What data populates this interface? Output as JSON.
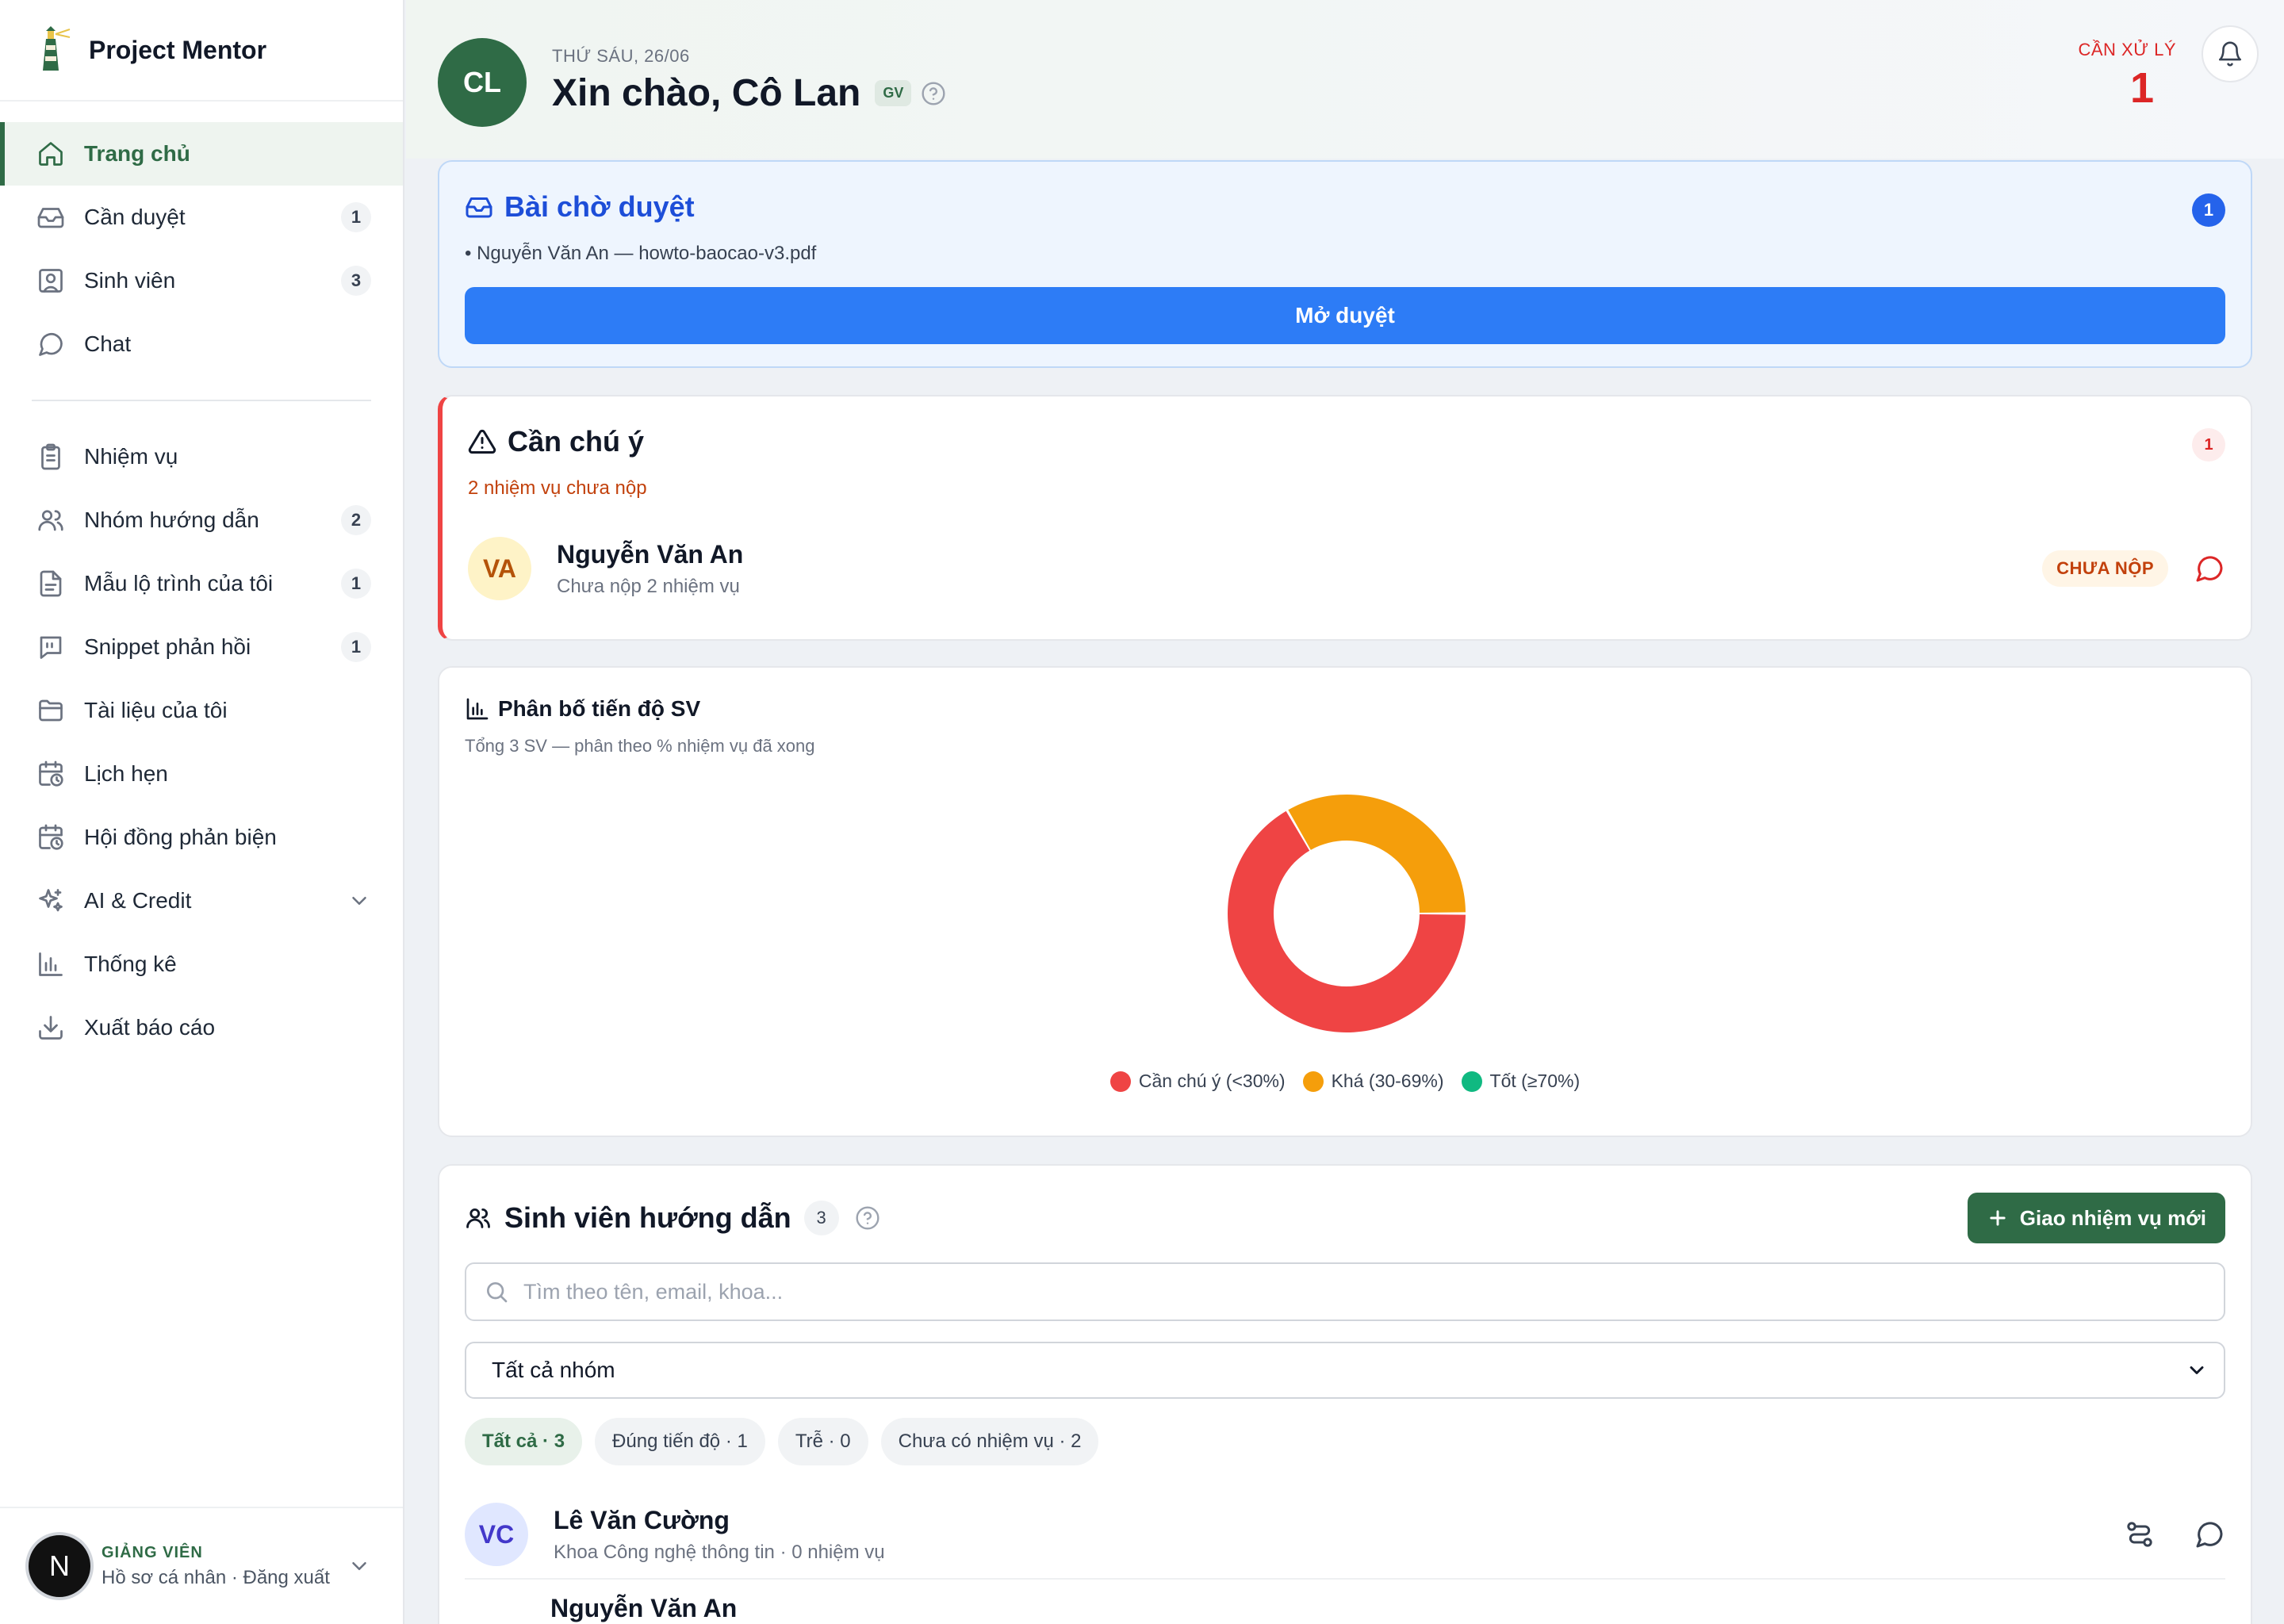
{
  "app": {
    "name": "Project Mentor"
  },
  "sidebar": {
    "items": [
      {
        "label": "Trang chủ",
        "icon": "home-icon",
        "active": true
      },
      {
        "label": "Cần duyệt",
        "icon": "inbox-icon",
        "badge": "1"
      },
      {
        "label": "Sinh viên",
        "icon": "user-square-icon",
        "badge": "3"
      },
      {
        "label": "Chat",
        "icon": "chat-icon"
      },
      {
        "label": "Nhiệm vụ",
        "icon": "clipboard-icon"
      },
      {
        "label": "Nhóm hướng dẫn",
        "icon": "users-icon",
        "badge": "2"
      },
      {
        "label": "Mẫu lộ trình của tôi",
        "icon": "file-icon",
        "badge": "1"
      },
      {
        "label": "Snippet phản hồi",
        "icon": "quote-icon",
        "badge": "1"
      },
      {
        "label": "Tài liệu của tôi",
        "icon": "folder-icon"
      },
      {
        "label": "Lịch hẹn",
        "icon": "calendar-clock-icon"
      },
      {
        "label": "Hội đồng phản biện",
        "icon": "calendar-clock-icon"
      },
      {
        "label": "AI & Credit",
        "icon": "sparkles-icon"
      },
      {
        "label": "Thống kê",
        "icon": "bar-chart-icon"
      },
      {
        "label": "Xuất báo cáo",
        "icon": "download-icon"
      }
    ]
  },
  "profile": {
    "avatar": "N",
    "role": "GIẢNG VIÊN",
    "links": "Hồ sơ cá nhân · Đăng xuất"
  },
  "header": {
    "avatar": "CL",
    "date": "THỨ SÁU, 26/06",
    "greeting": "Xin chào, Cô Lan",
    "role_badge": "GV",
    "pending_label": "CẦN XỬ LÝ",
    "pending_count": "1"
  },
  "review": {
    "title": "Bài chờ duyệt",
    "count": "1",
    "item": "• Nguyễn Văn An — howto-baocao-v3.pdf",
    "button": "Mở duyệt"
  },
  "attention": {
    "title": "Cần chú ý",
    "count": "1",
    "subtitle": "2 nhiệm vụ chưa nộp",
    "student": {
      "initials": "VA",
      "name": "Nguyễn Văn An",
      "desc": "Chưa nộp 2 nhiệm vụ",
      "status": "CHƯA NỘP"
    }
  },
  "chart_section": {
    "title": "Phân bố tiến độ SV",
    "subtitle": "Tổng 3 SV — phân theo % nhiệm vụ đã xong"
  },
  "chart_data": {
    "type": "pie",
    "donut": true,
    "categories": [
      "Cần chú ý (<30%)",
      "Khá (30-69%)",
      "Tốt (≥70%)"
    ],
    "values": [
      2,
      1,
      0
    ],
    "colors": [
      "#ef4444",
      "#f59e0b",
      "#10b981"
    ],
    "legend": "bottom"
  },
  "students": {
    "title": "Sinh viên hướng dẫn",
    "count": "3",
    "new_task_button": "Giao nhiệm vụ mới",
    "search_placeholder": "Tìm theo tên, email, khoa...",
    "group_select": "Tất cả nhóm",
    "filters": [
      "Tất cả · 3",
      "Đúng tiến độ · 1",
      "Trễ · 0",
      "Chưa có nhiệm vụ · 2"
    ],
    "rows": [
      {
        "initials": "VC",
        "name": "Lê Văn Cường",
        "desc": "Khoa Công nghệ thông tin · 0 nhiệm vụ"
      },
      {
        "name": "Nguyễn Văn An"
      }
    ]
  }
}
